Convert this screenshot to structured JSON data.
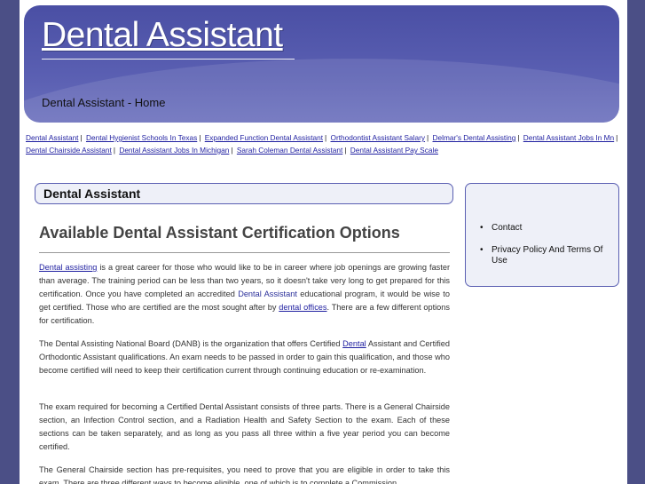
{
  "header": {
    "site_title": "Dental Assistant",
    "breadcrumb": "Dental Assistant - Home"
  },
  "nav_links": [
    "Dental Assistant",
    "Dental Hygienist Schools In Texas",
    "Expanded Function Dental Assistant",
    "Orthodontist Assistant Salary",
    "Delmar's Dental Assisting",
    "Dental Assistant Jobs In Mn",
    "Dental Chairside Assistant",
    "Dental Assistant Jobs In Michigan",
    "Sarah Coleman Dental Assistant",
    "Dental Assistant Pay Scale"
  ],
  "nav_separator": "|",
  "section_heading": "Dental Assistant",
  "sidebar": {
    "items": [
      "Contact",
      "Privacy Policy And Terms Of Use"
    ]
  },
  "article": {
    "title": "Available Dental Assistant Certification Options",
    "p1": {
      "link1": "Dental assisting",
      "t1": " is a great career for those who would like to be in career where job openings are growing faster than average. The training period can be less than two years, so it doesn't take very long to get prepared for this certification. Once you have completed an accredited ",
      "hl1": "Dental Assistant",
      "t2": " educational program, it would be wise to get certified. Those who are certified are the most sought after by ",
      "link2": "dental offices",
      "t3": ". There are a few different options for certification."
    },
    "p2": {
      "t1": "The Dental Assisting National Board (DANB) is the organization that offers Certified ",
      "link1": "Dental",
      "t2": " Assistant and Certified Orthodontic Assistant qualifications. An exam needs to be passed in order to gain this qualification, and those who become certified will need to keep their certification current through continuing education or re-examination."
    },
    "p3": " The exam required for becoming a Certified Dental Assistant consists of three parts. There is a General Chairside section, an Infection Control section, and a Radiation Health and Safety Section to the exam. Each of these sections can be taken separately, and as long as you pass all three within a five year period you can become certified.",
    "p4": "The General Chairside section has pre-requisites, you need to prove that you are eligible in order to take this exam. There are three different ways to become eligible, one of which is to complete a Commission"
  }
}
